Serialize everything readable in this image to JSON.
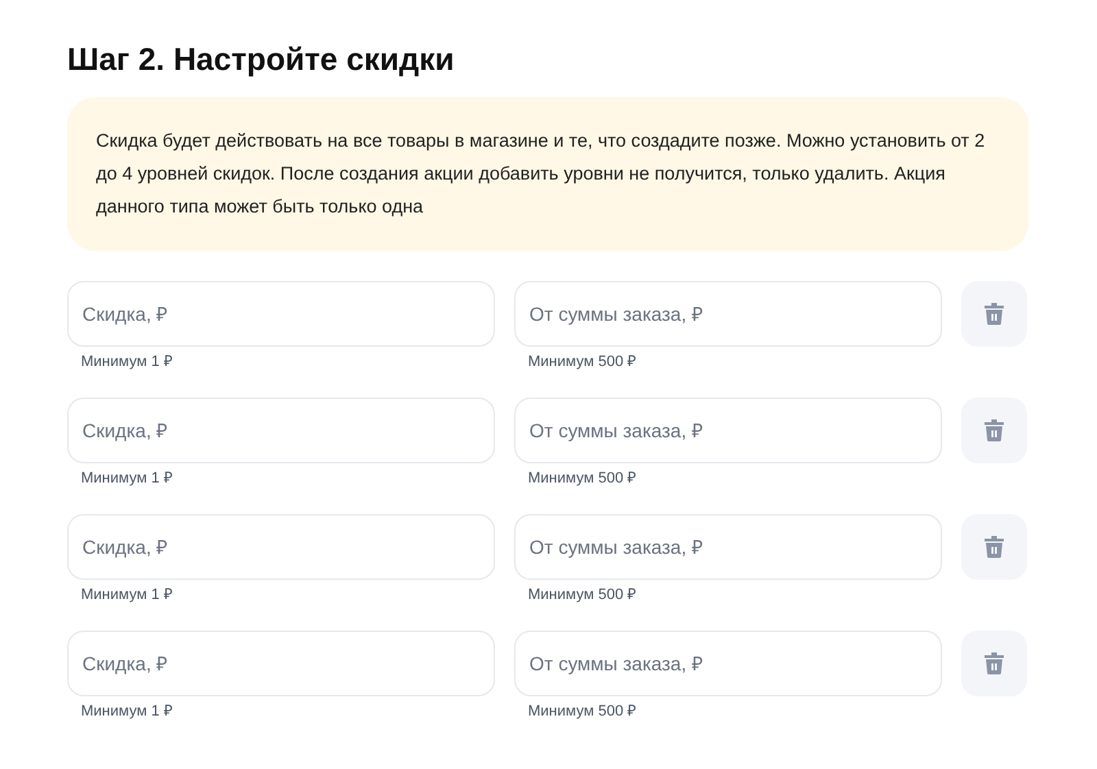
{
  "title": "Шаг 2. Настройте скидки",
  "notice": "Скидка будет действовать на все товары в магазине и те, что создадите позже. Можно установить от 2 до 4 уровней скидок. После создания акции добавить уровни не получится, только удалить. Акция данного типа может быть только одна",
  "levels": [
    {
      "discount": {
        "placeholder": "Скидка, ₽",
        "hint": "Минимум 1 ₽"
      },
      "threshold": {
        "placeholder": "От суммы заказа, ₽",
        "hint": "Минимум 500 ₽"
      }
    },
    {
      "discount": {
        "placeholder": "Скидка, ₽",
        "hint": "Минимум 1 ₽"
      },
      "threshold": {
        "placeholder": "От суммы заказа, ₽",
        "hint": "Минимум 500 ₽"
      }
    },
    {
      "discount": {
        "placeholder": "Скидка, ₽",
        "hint": "Минимум 1 ₽"
      },
      "threshold": {
        "placeholder": "От суммы заказа, ₽",
        "hint": "Минимум 500 ₽"
      }
    },
    {
      "discount": {
        "placeholder": "Скидка, ₽",
        "hint": "Минимум 1 ₽"
      },
      "threshold": {
        "placeholder": "От суммы заказа, ₽",
        "hint": "Минимум 500 ₽"
      }
    }
  ]
}
